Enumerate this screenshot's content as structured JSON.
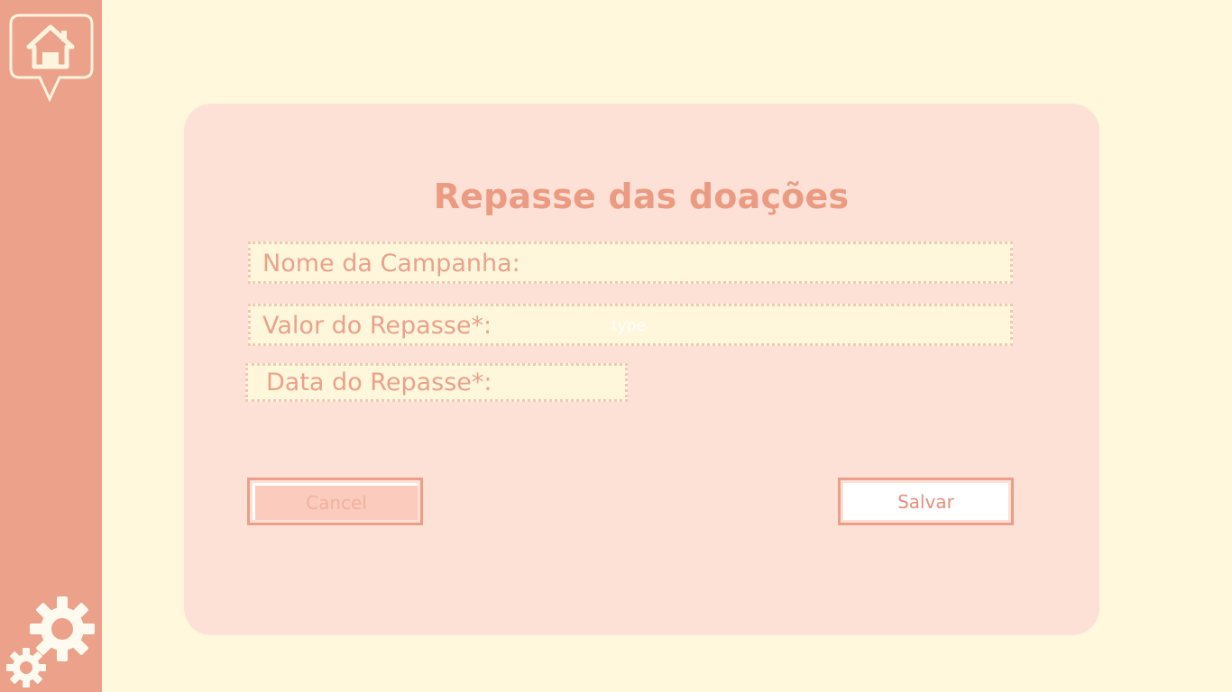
{
  "form": {
    "title": "Repasse das doações",
    "fields": [
      {
        "label": "Nome da Campanha:",
        "placeholder": "",
        "value": ""
      },
      {
        "label": "Valor do Repasse*:",
        "placeholder": "type",
        "value": ""
      },
      {
        "label": "Data do Repasse*:",
        "placeholder": "",
        "value": ""
      }
    ],
    "cancel_label": "Cancel",
    "save_label": "Salvar"
  },
  "colors": {
    "sidebar": "#eba18a",
    "background": "#fff8dd",
    "panel": "#fde1d6",
    "accent": "#ea9b82"
  },
  "icons": {
    "home": "home-icon",
    "settings": "gears-icon"
  }
}
